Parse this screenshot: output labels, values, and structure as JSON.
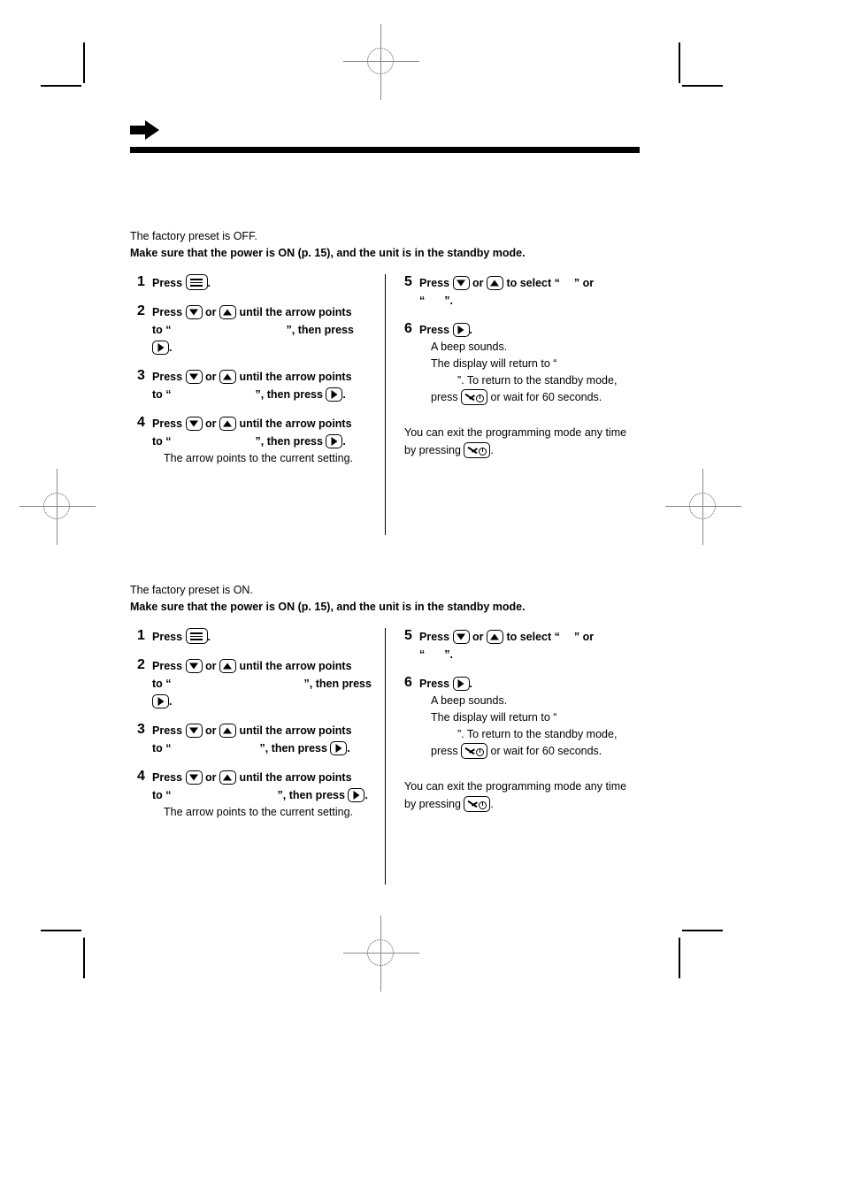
{
  "page": {
    "header_icon": "right-arrow-icon",
    "blank_display_placeholder": ""
  },
  "sections": [
    {
      "id": "section-off",
      "intro_normal": "The factory preset is OFF.",
      "intro_bold": "Make sure that the power is ON (p. 15), and the unit is in the standby mode.",
      "left_steps": [
        {
          "num": "1",
          "parts": [
            "Press ",
            "[menu-button]",
            "."
          ]
        },
        {
          "num": "2",
          "line1_a": "Press ",
          "line1_b": " or ",
          "line1_c": " until the arrow points",
          "line2_a": "to “",
          "line2_display": "",
          "line2_b": "”, then press",
          "line3_b": "."
        },
        {
          "num": "3",
          "line1_a": "Press ",
          "line1_b": " or ",
          "line1_c": " until the arrow points",
          "line2_a": "to “",
          "line2_display": "",
          "line2_b": "”, then press ",
          "line2_c": "."
        },
        {
          "num": "4",
          "line1_a": "Press ",
          "line1_b": " or ",
          "line1_c": " until the arrow points",
          "line2_a": "to “",
          "line2_display": "",
          "line2_b": "”, then press ",
          "line2_c": ".",
          "note": "The arrow points to the current setting."
        }
      ],
      "right_steps": [
        {
          "num": "5",
          "line1_a": "Press ",
          "line1_b": " or ",
          "line1_c": " to select “",
          "line1_display": "",
          "line1_d": "” or",
          "line2_a": "“",
          "line2_display": "",
          "line2_b": "”."
        },
        {
          "num": "6",
          "line1_a": "Press ",
          "line1_b": ".",
          "note1": "A beep sounds.",
          "note2_a": "The display will return to “",
          "note2_display": "",
          "note3_a": "”. To return to the standby mode,",
          "note4_a": "press ",
          "note4_b": " or wait for 60 seconds."
        }
      ],
      "tail": {
        "line1": "You can exit the programming mode any time",
        "line2_a": "by pressing ",
        "line2_b": "."
      }
    },
    {
      "id": "section-on",
      "intro_normal": "The factory preset is ON.",
      "intro_bold": "Make sure that the power is ON (p. 15), and the unit is in the standby mode.",
      "left_steps": [
        {
          "num": "1",
          "parts": [
            "Press ",
            "[menu-button]",
            "."
          ]
        },
        {
          "num": "2",
          "line1_a": "Press ",
          "line1_b": " or ",
          "line1_c": " until the arrow points",
          "line2_a": "to “",
          "line2_display": "",
          "line2_b": "”, then press",
          "line3_b": "."
        },
        {
          "num": "3",
          "line1_a": "Press ",
          "line1_b": " or ",
          "line1_c": " until the arrow points",
          "line2_a": "to “",
          "line2_display": "",
          "line2_b": "”, then press ",
          "line2_c": "."
        },
        {
          "num": "4",
          "line1_a": "Press ",
          "line1_b": " or ",
          "line1_c": " until the arrow points",
          "line2_a": "to “",
          "line2_display": "",
          "line2_b": "”, then press ",
          "line2_c": ".",
          "note": "The arrow points to the current setting."
        }
      ],
      "right_steps": [
        {
          "num": "5",
          "line1_a": "Press ",
          "line1_b": " or ",
          "line1_c": " to select “",
          "line1_display": "",
          "line1_d": "” or",
          "line2_a": "“",
          "line2_display": "",
          "line2_b": "”."
        },
        {
          "num": "6",
          "line1_a": "Press ",
          "line1_b": ".",
          "note1": "A beep sounds.",
          "note2_a": "The display will return to “",
          "note2_display": "",
          "note3_a": "”. To return to the standby mode,",
          "note4_a": "press ",
          "note4_b": " or wait for 60 seconds."
        }
      ],
      "tail": {
        "line1": "You can exit the programming mode any time",
        "line2_a": "by pressing ",
        "line2_b": "."
      }
    }
  ],
  "icons": {
    "menu": "menu-button-icon",
    "down": "down-arrow-button-icon",
    "up": "up-arrow-button-icon",
    "right": "right-arrow-button-icon",
    "standby": "standby-off-button-icon"
  }
}
